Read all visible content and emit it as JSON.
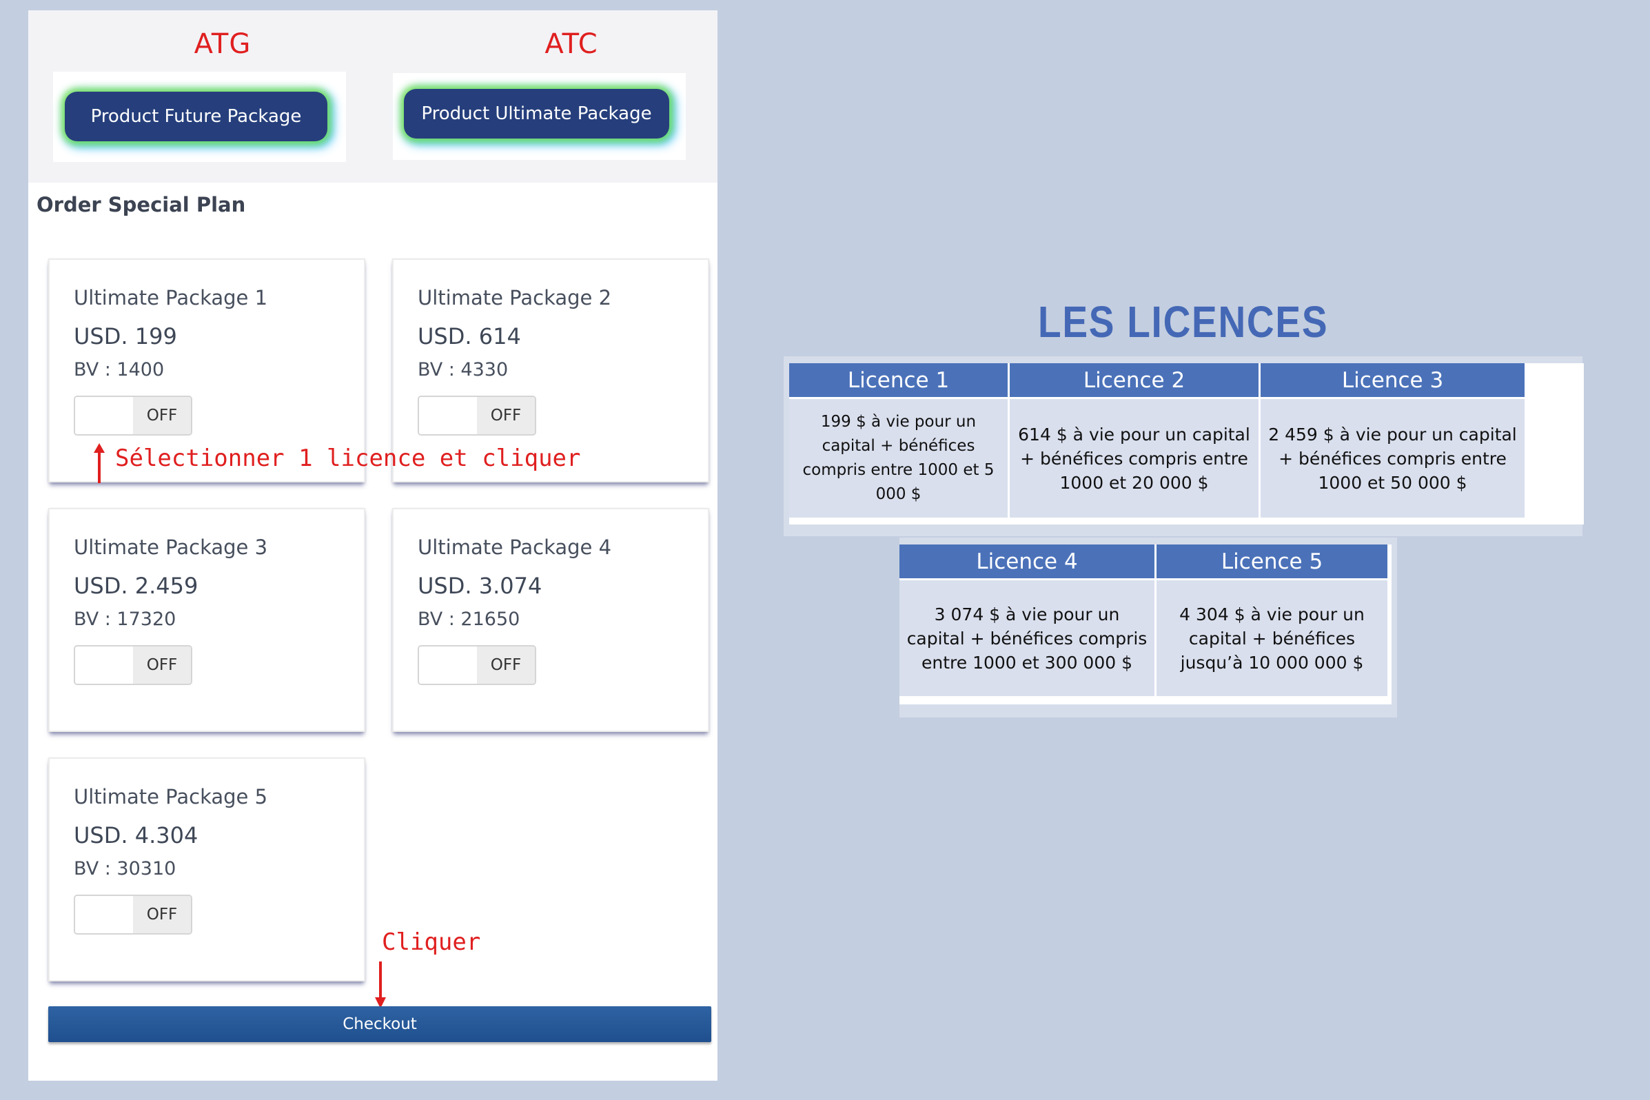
{
  "packages": {
    "atg": {
      "label": "ATG",
      "button": "Product Future Package"
    },
    "atc": {
      "label": "ATC",
      "button": "Product Ultimate Package"
    }
  },
  "section_title": "Order Special Plan",
  "cards": [
    {
      "title": "Ultimate Package 1",
      "price": "USD. 199",
      "bv": "BV : 1400",
      "toggle": "OFF"
    },
    {
      "title": "Ultimate Package 2",
      "price": "USD. 614",
      "bv": "BV : 4330",
      "toggle": "OFF"
    },
    {
      "title": "Ultimate Package 3",
      "price": "USD. 2.459",
      "bv": "BV : 17320",
      "toggle": "OFF"
    },
    {
      "title": "Ultimate Package 4",
      "price": "USD. 3.074",
      "bv": "BV : 21650",
      "toggle": "OFF"
    },
    {
      "title": "Ultimate Package 5",
      "price": "USD. 4.304",
      "bv": "BV : 30310",
      "toggle": "OFF"
    }
  ],
  "annotations": {
    "select": "Sélectionner 1 licence et cliquer",
    "click": "Cliquer"
  },
  "checkout_label": "Checkout",
  "licences": {
    "title": "LES LICENCES",
    "items": [
      {
        "name": "Licence 1",
        "desc": "199 $ à vie pour un capital + bénéfices compris entre 1000 et 5 000 $"
      },
      {
        "name": "Licence 2",
        "desc": "614 $ à vie pour un capital + bénéfices compris entre 1000 et 20 000 $"
      },
      {
        "name": "Licence 3",
        "desc": "2 459 $ à vie pour un capital + bénéfices compris entre 1000 et 50 000 $"
      },
      {
        "name": "Licence 4",
        "desc": "3 074 $ à vie pour un capital + bénéfices compris entre 1000 et 300 000 $"
      },
      {
        "name": "Licence 5",
        "desc": "4 304 $ à vie pour un capital + bénéfices jusqu’à 10 000 000 $"
      }
    ]
  },
  "colors": {
    "annotation_red": "#e01f1f",
    "package_button": "#263f7c",
    "licence_header": "#4b72b9",
    "licence_title": "#4468b5",
    "checkout": "#2a5b9b",
    "page_background": "#c3cee0"
  },
  "icons": [
    "arrow-up-icon",
    "arrow-down-icon"
  ]
}
